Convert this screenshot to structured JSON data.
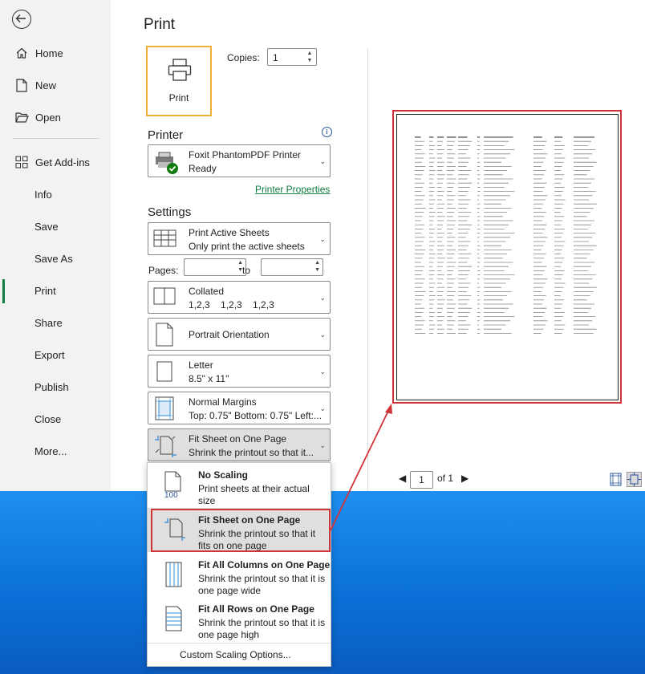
{
  "nav": {
    "items": [
      {
        "label": "Home",
        "icon": "home-icon"
      },
      {
        "label": "New",
        "icon": "new-document-icon"
      },
      {
        "label": "Open",
        "icon": "open-folder-icon"
      },
      {
        "label": "Get Add-ins",
        "icon": "add-ins-grid-icon"
      },
      {
        "label": "Info"
      },
      {
        "label": "Save"
      },
      {
        "label": "Save As"
      },
      {
        "label": "Print"
      },
      {
        "label": "Share"
      },
      {
        "label": "Export"
      },
      {
        "label": "Publish"
      },
      {
        "label": "Close"
      },
      {
        "label": "More..."
      }
    ],
    "active": "Print",
    "accent": "#107c41"
  },
  "print": {
    "title": "Print",
    "print_button": "Print",
    "copies_label": "Copies:",
    "copies_value": "1",
    "printer_section": "Printer",
    "printer_name": "Foxit PhantomPDF Printer",
    "printer_status": "Ready",
    "printer_properties": "Printer Properties",
    "settings_section": "Settings",
    "sheets_main": "Print Active Sheets",
    "sheets_sub": "Only print the active sheets",
    "pages_label": "Pages:",
    "to_label": "to",
    "collated_main": "Collated",
    "collated_sub": "1,2,3    1,2,3    1,2,3",
    "orientation": "Portrait Orientation",
    "paper_main": "Letter",
    "paper_sub": "8.5\" x 11\"",
    "margins_main": "Normal Margins",
    "margins_sub": "Top: 0.75\" Bottom: 0.75\" Left:...",
    "scaling_main": "Fit Sheet on One Page",
    "scaling_sub": "Shrink the printout so that it..."
  },
  "preview": {
    "page_value": "1",
    "of_label": "of 1",
    "highlight_color": "#d13438"
  },
  "scaling_menu": {
    "items": [
      {
        "title": "No Scaling",
        "desc": "Print sheets at their actual size",
        "icon": "no-scaling-icon"
      },
      {
        "title": "Fit Sheet on One Page",
        "desc": "Shrink the printout so that it fits on one page",
        "icon": "fit-sheet-icon"
      },
      {
        "title": "Fit All Columns on One Page",
        "desc": "Shrink the printout so that it is one page wide",
        "icon": "fit-columns-icon"
      },
      {
        "title": "Fit All Rows on One Page",
        "desc": "Shrink the printout so that it is one page high",
        "icon": "fit-rows-icon"
      }
    ],
    "selected": "Fit Sheet on One Page",
    "no_scaling_icon_text": "100",
    "custom": "Custom Scaling Options..."
  }
}
